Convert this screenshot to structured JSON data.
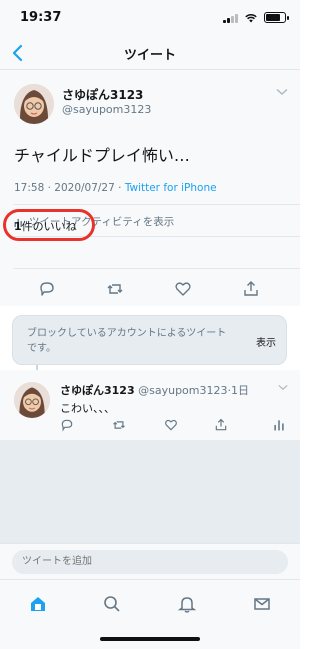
{
  "status": {
    "time": "19:37"
  },
  "nav": {
    "title": "ツイート"
  },
  "tweet": {
    "user_name": "さゆぽん3123",
    "user_handle": "@sayupom3123",
    "text": "チャイルドプレイ怖い…",
    "time": "17:58 · 2020/07/27 · ",
    "client": "Twitter for iPhone",
    "activity_label": "ツイートアクティビティを表示",
    "likes_count": "1",
    "likes_suffix": "件のいいね"
  },
  "blocked": {
    "message": "ブロックしているアカウントによるツイートです。",
    "show_label": "表示"
  },
  "reply": {
    "user_name": "さゆぽん3123",
    "user_handle": " @sayupom3123",
    "time": "·1日",
    "text": "こわい、、、"
  },
  "compose": {
    "placeholder": "ツイートを追加"
  },
  "colors": {
    "accent": "#1da1f2",
    "highlight": "#e8322b",
    "muted": "#657786"
  }
}
